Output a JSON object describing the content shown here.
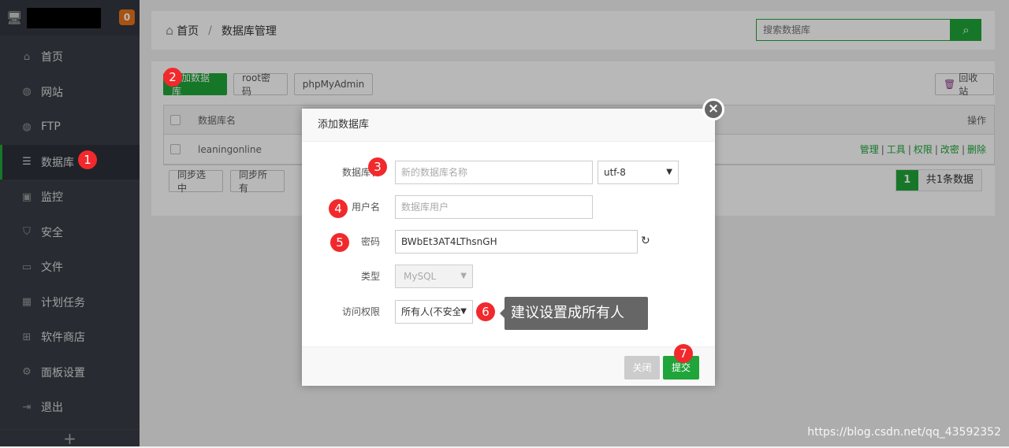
{
  "sidebar": {
    "badge": "0",
    "items": [
      {
        "label": "首页",
        "icon": "home-icon"
      },
      {
        "label": "网站",
        "icon": "globe-icon"
      },
      {
        "label": "FTP",
        "icon": "ftp-icon"
      },
      {
        "label": "数据库",
        "icon": "database-icon"
      },
      {
        "label": "监控",
        "icon": "monitor-icon"
      },
      {
        "label": "安全",
        "icon": "shield-icon"
      },
      {
        "label": "文件",
        "icon": "folder-icon"
      },
      {
        "label": "计划任务",
        "icon": "calendar-icon"
      },
      {
        "label": "软件商店",
        "icon": "grid-icon"
      },
      {
        "label": "面板设置",
        "icon": "gear-icon"
      },
      {
        "label": "退出",
        "icon": "logout-icon"
      }
    ],
    "add": "+"
  },
  "breadcrumb": {
    "home": "首页",
    "sep": "/",
    "current": "数据库管理"
  },
  "search": {
    "placeholder": "搜索数据库"
  },
  "toolbar": {
    "add": "添加数据库",
    "root": "root密码",
    "pma": "phpMyAdmin",
    "recycle": "回收站"
  },
  "table": {
    "headers": {
      "name": "数据库名",
      "ops": "操作"
    },
    "rows": [
      {
        "name": "leaningonline",
        "ops": [
          "管理",
          "工具",
          "权限",
          "改密",
          "删除"
        ]
      }
    ]
  },
  "bottom": {
    "sync_selected": "同步选中",
    "sync_all": "同步所有"
  },
  "pager": {
    "current": "1",
    "total": "共1条数据"
  },
  "modal": {
    "title": "添加数据库",
    "db_label": "数据库名",
    "db_placeholder": "新的数据库名称",
    "charset": "utf-8",
    "user_label": "用户名",
    "user_placeholder": "数据库用户",
    "pwd_label": "密码",
    "pwd_value": "BWbEt3AT4LThsnGH",
    "type_label": "类型",
    "type_value": "MySQL",
    "access_label": "访问权限",
    "access_value": "所有人(不安全)",
    "close": "关闭",
    "submit": "提交"
  },
  "annotations": {
    "n1": "1",
    "n2": "2",
    "n3": "3",
    "n4": "4",
    "n5": "5",
    "n6": "6",
    "n7": "7",
    "tip": "建议设置成所有人"
  },
  "watermark": "https://blog.csdn.net/qq_43592352"
}
